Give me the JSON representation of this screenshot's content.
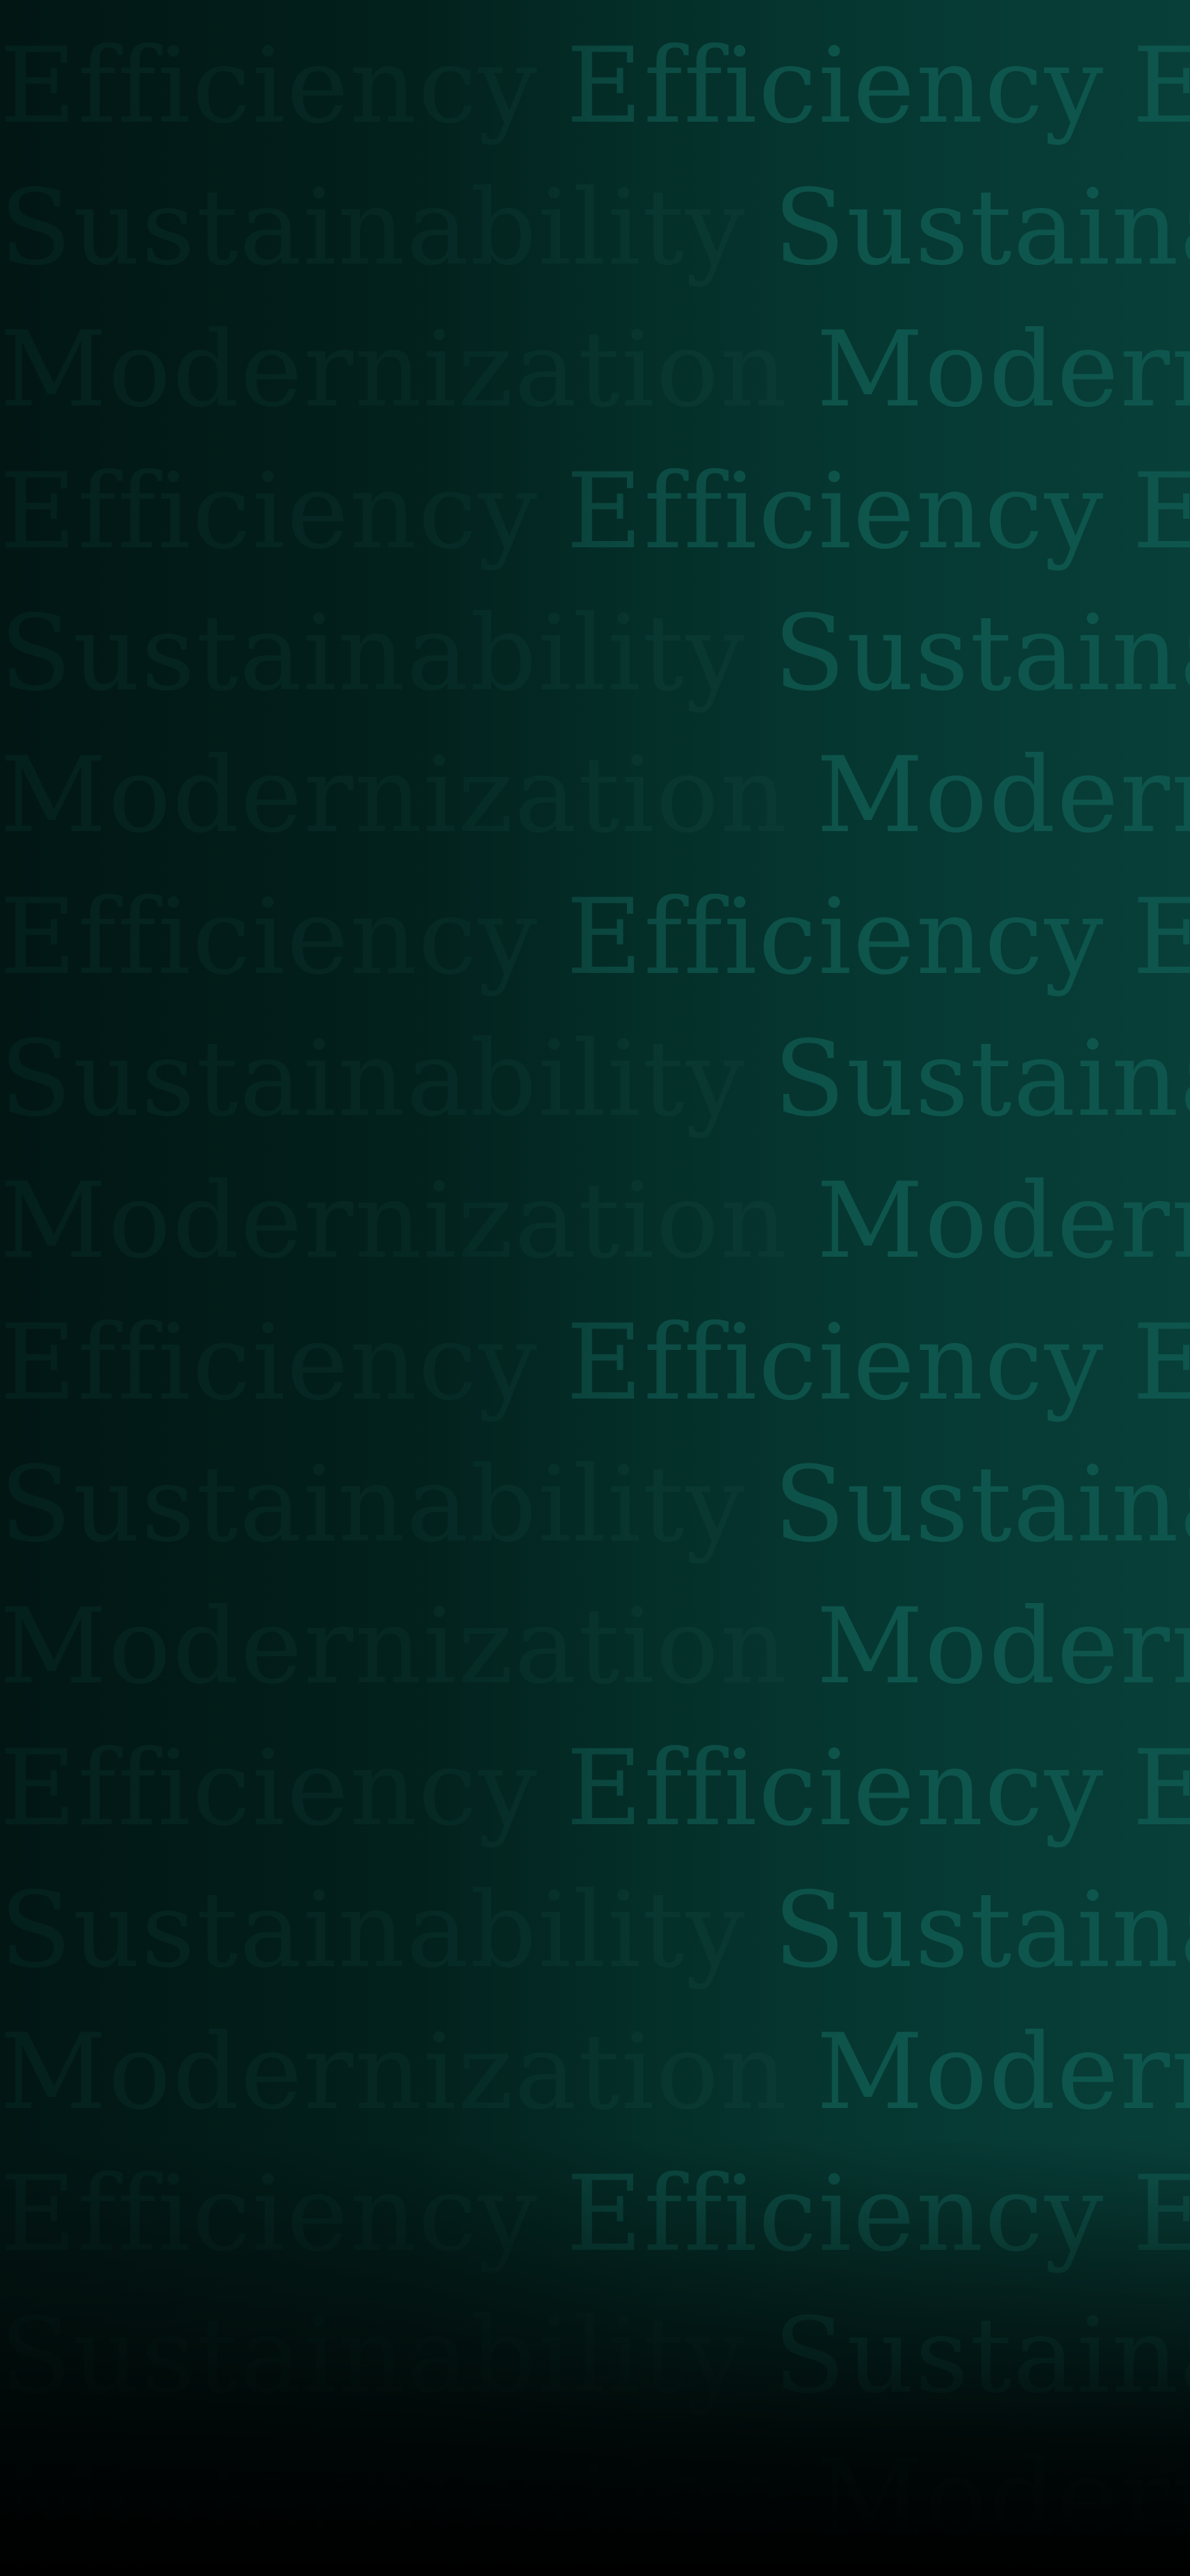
{
  "background_colors": {
    "dark": "#021d1a",
    "mid": "#04302a",
    "light": "#083f39",
    "text": "#0e564d"
  },
  "repeated_words": [
    "Efficiency",
    "Sustainability",
    "Modernization"
  ],
  "rows": [
    {
      "words": [
        "Efficiency",
        "Efficiency",
        "Efficiency"
      ]
    },
    {
      "words": [
        "Sustainability",
        "Sustainability"
      ]
    },
    {
      "words": [
        "Modernization",
        "Modernization"
      ]
    },
    {
      "words": [
        "Efficiency",
        "Efficiency",
        "Efficiency"
      ]
    },
    {
      "words": [
        "Sustainability",
        "Sustainability"
      ]
    },
    {
      "words": [
        "Modernization",
        "Modernization"
      ]
    },
    {
      "words": [
        "Efficiency",
        "Efficiency",
        "Efficiency"
      ]
    },
    {
      "words": [
        "Sustainability",
        "Sustainability"
      ]
    },
    {
      "words": [
        "Modernization",
        "Modernization"
      ]
    },
    {
      "words": [
        "Efficiency",
        "Efficiency",
        "Efficiency"
      ]
    },
    {
      "words": [
        "Sustainability",
        "Sustainability"
      ]
    },
    {
      "words": [
        "Modernization",
        "Modernization"
      ]
    },
    {
      "words": [
        "Efficiency",
        "Efficiency",
        "Efficiency"
      ]
    },
    {
      "words": [
        "Sustainability",
        "Sustainability"
      ]
    },
    {
      "words": [
        "Modernization",
        "Modernization"
      ]
    },
    {
      "words": [
        "Efficiency",
        "Efficiency",
        "Efficiency"
      ]
    },
    {
      "words": [
        "Sustainability",
        "Sustainability"
      ]
    },
    {
      "words": [
        "Modernization",
        "Modernization"
      ]
    }
  ]
}
